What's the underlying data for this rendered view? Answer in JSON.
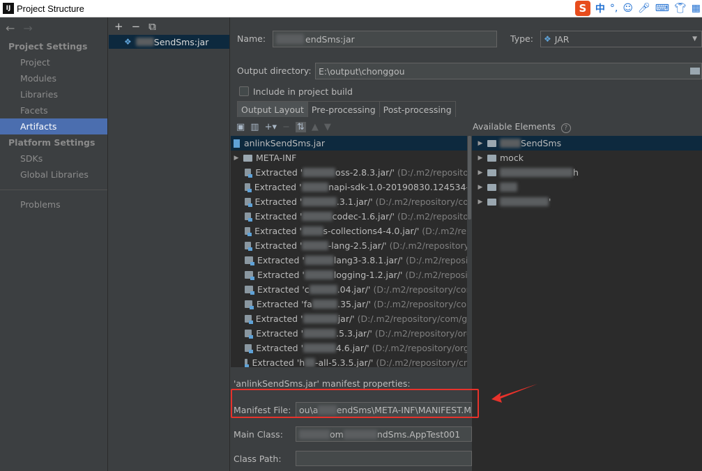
{
  "window": {
    "title": "Project Structure",
    "app_icon": "IJ"
  },
  "ime": {
    "logo": "S",
    "lang": "中",
    "icons": [
      "punctuation-icon",
      "emoji-icon",
      "microphone-icon",
      "keyboard-icon",
      "shirt-icon",
      "toolbox-icon"
    ]
  },
  "nav": {
    "back_icon": "←",
    "forward_icon": "→",
    "project_settings_title": "Project Settings",
    "project_settings_items": [
      "Project",
      "Modules",
      "Libraries",
      "Facets",
      "Artifacts"
    ],
    "platform_settings_title": "Platform Settings",
    "platform_settings_items": [
      "SDKs",
      "Global Libraries"
    ],
    "problems": "Problems",
    "selected": "Artifacts"
  },
  "artifact_list": {
    "toolbar": [
      "+",
      "−",
      "⧉"
    ],
    "items": [
      {
        "label": "SendSms:jar"
      }
    ]
  },
  "form": {
    "name_label": "Name:",
    "name_value": "endSms:jar",
    "type_label": "Type:",
    "type_value": "JAR",
    "output_dir_label": "Output directory:",
    "output_dir_value": "E:\\output\\chonggou",
    "include_in_build_label": "Include in project build",
    "include_in_build_checked": false
  },
  "tabs": [
    "Output Layout",
    "Pre-processing",
    "Post-processing"
  ],
  "available_elements_title": "Available Elements",
  "output_tree": [
    {
      "kind": "jar",
      "label": "anlinkSendSms.jar",
      "path": ""
    },
    {
      "kind": "folder",
      "label": "META-INF",
      "path": ""
    },
    {
      "kind": "extracted",
      "label": "Extracted '",
      "name": "oss-2.8.3.jar/'",
      "path": "(D:/.m2/repositor"
    },
    {
      "kind": "extracted",
      "label": "Extracted '",
      "name": "napi-sdk-1.0-20190830.124534-",
      "path": ""
    },
    {
      "kind": "extracted",
      "label": "Extracted '",
      "name": ".3.1.jar/'",
      "path": "(D:/.m2/repository/cor"
    },
    {
      "kind": "extracted",
      "label": "Extracted '",
      "name": "codec-1.6.jar/'",
      "path": "(D:/.m2/repositor"
    },
    {
      "kind": "extracted",
      "label": "Extracted '",
      "name": "s-collections4-4.0.jar/'",
      "path": "(D:/.m2/rep"
    },
    {
      "kind": "extracted",
      "label": "Extracted '",
      "name": "-lang-2.5.jar/'",
      "path": "(D:/.m2/repository,"
    },
    {
      "kind": "extracted",
      "label": "Extracted '",
      "name": "lang3-3.8.1.jar/'",
      "path": "(D:/.m2/reposit"
    },
    {
      "kind": "extracted",
      "label": "Extracted '",
      "name": "logging-1.2.jar/'",
      "path": "(D:/.m2/reposi"
    },
    {
      "kind": "extracted",
      "label": "Extracted 'c",
      "name": ".04.jar/'",
      "path": "(D:/.m2/repository/con"
    },
    {
      "kind": "extracted",
      "label": "Extracted 'fa",
      "name": ".35.jar/'",
      "path": "(D:/.m2/repository/con"
    },
    {
      "kind": "extracted",
      "label": "Extracted '",
      "name": "jar/'",
      "path": "(D:/.m2/repository/com/gc"
    },
    {
      "kind": "extracted",
      "label": "Extracted '",
      "name": ".5.3.jar/'",
      "path": "(D:/.m2/repository/org"
    },
    {
      "kind": "extracted",
      "label": "Extracted '",
      "name": "4.6.jar/'",
      "path": "(D:/.m2/repository/org/"
    },
    {
      "kind": "extracted",
      "label": "Extracted 'h",
      "name": "-all-5.3.5.jar/'",
      "path": "(D:/.m2/repository/cn/"
    }
  ],
  "available_tree": [
    {
      "label": "SendSms"
    },
    {
      "label": "mock"
    },
    {
      "label": "h"
    },
    {
      "label": ""
    },
    {
      "label": "'"
    }
  ],
  "manifest": {
    "title": "'anlinkSendSms.jar' manifest properties:",
    "manifest_file_label": "Manifest File:",
    "manifest_file_value": "ou\\a",
    "manifest_file_value_tail": "endSms\\META-INF\\MANIFEST.M",
    "main_class_label": "Main Class:",
    "main_class_value": "om",
    "main_class_value_tail": "ndSms.AppTest001",
    "class_path_label": "Class Path:",
    "class_path_value": ""
  },
  "colors": {
    "accent": "#4b6eaf",
    "selection": "#0d293e",
    "highlight_box": "#e8322b"
  }
}
